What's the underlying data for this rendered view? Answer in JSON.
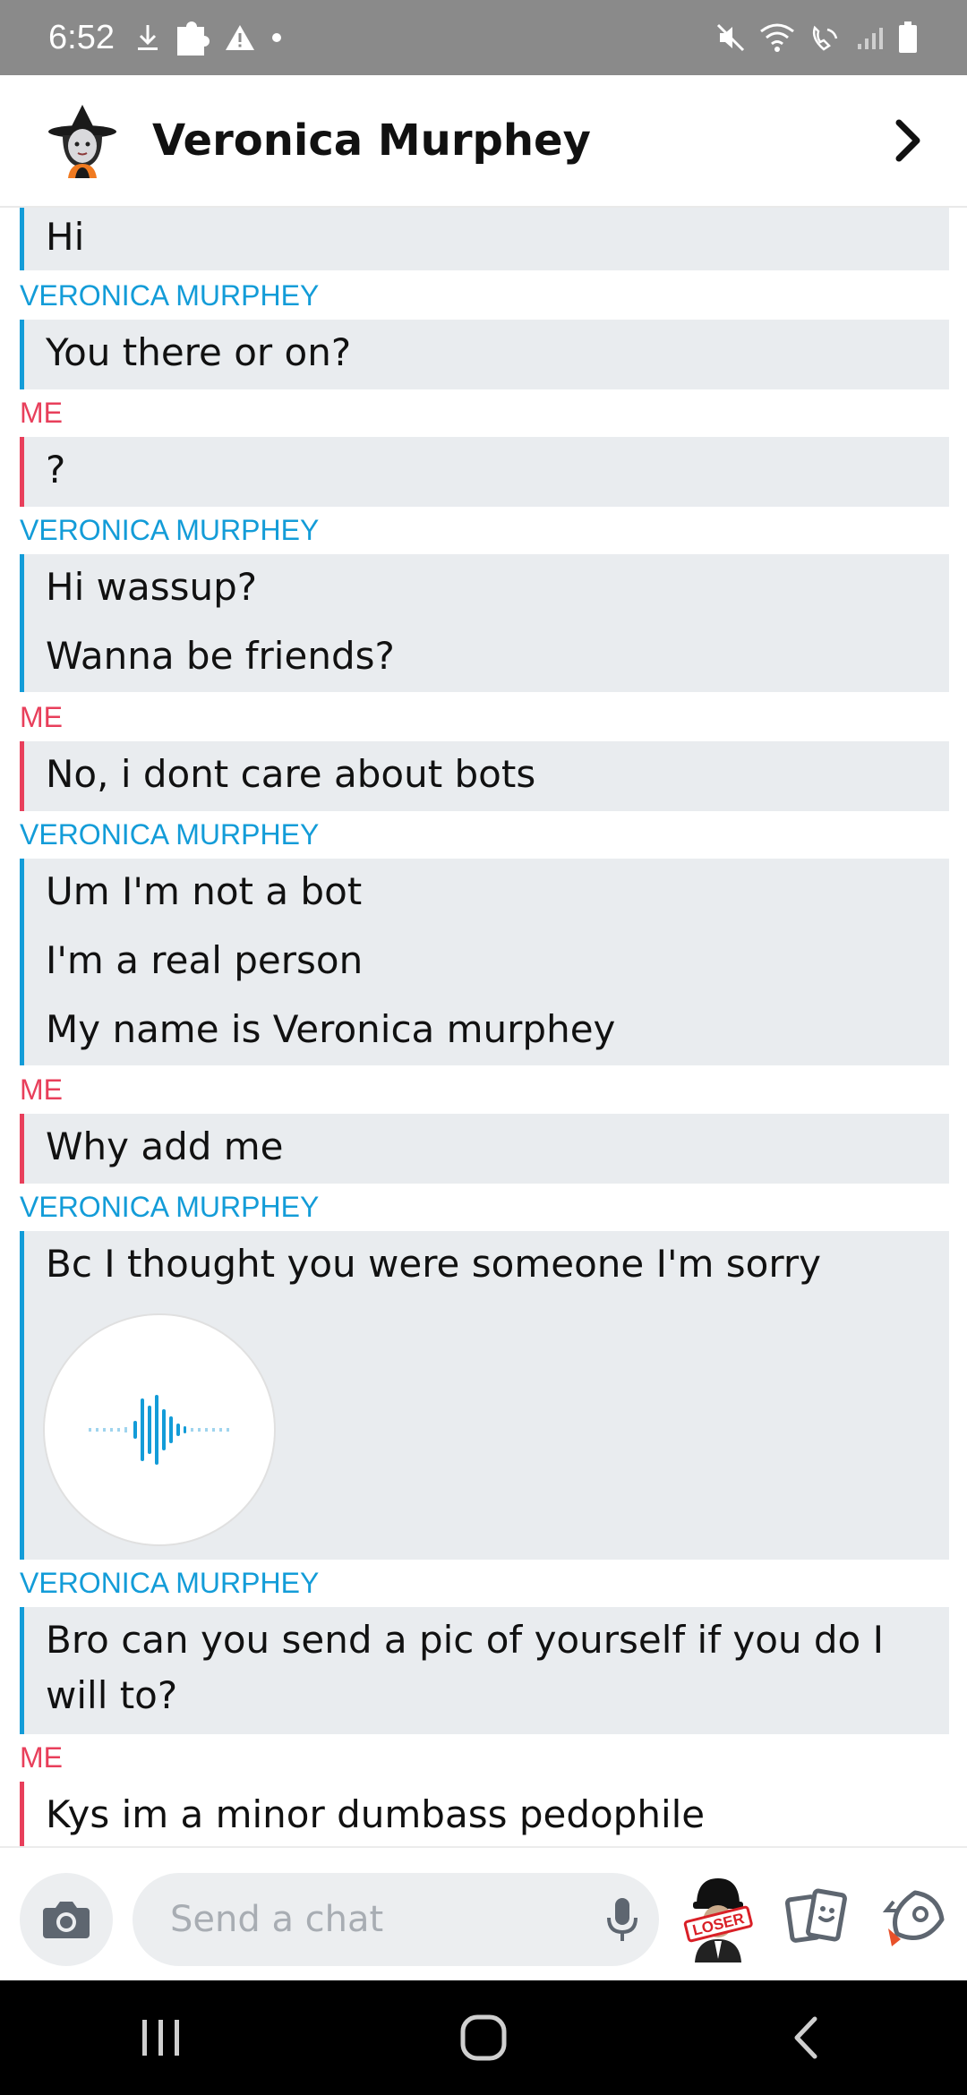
{
  "status_bar": {
    "time": "6:52",
    "left_icons": [
      "download-icon",
      "puzzle-icon",
      "warning-icon",
      "dot-icon"
    ],
    "right_icons": [
      "mute-icon",
      "wifi-icon",
      "wifi-calling-icon",
      "signal-icon",
      "battery-icon"
    ]
  },
  "header": {
    "contact_name": "Veronica Murphey",
    "avatar": "bitmoji-witch-avatar",
    "chevron": "chevron-right-icon"
  },
  "colors": {
    "them": "#139cd8",
    "me": "#e83f5b",
    "bubble_bg": "#e9ecef",
    "status_bar": "#8a8a8a"
  },
  "messages": {
    "g0": {
      "lines": [
        "Hi"
      ]
    },
    "g1": {
      "sender": "VERONICA MURPHEY",
      "lines": [
        "You there or on?"
      ]
    },
    "g2": {
      "sender": "ME",
      "lines": [
        "?"
      ]
    },
    "g3": {
      "sender": "VERONICA MURPHEY",
      "lines": [
        "Hi wassup?",
        "Wanna be friends?"
      ]
    },
    "g4": {
      "sender": "ME",
      "lines": [
        "No, i dont care about bots"
      ]
    },
    "g5": {
      "sender": "VERONICA MURPHEY",
      "lines": [
        "Um I'm not a bot",
        "I'm a real person",
        "My name is Veronica murphey"
      ]
    },
    "g6": {
      "sender": "ME",
      "lines": [
        "Why add me"
      ]
    },
    "g7": {
      "sender": "VERONICA MURPHEY",
      "lines": [
        "Bc I thought you were someone I'm sorry"
      ],
      "attachment": "voice-note"
    },
    "g8": {
      "sender": "VERONICA MURPHEY",
      "lines": [
        "Bro can you send a pic of yourself if you do I",
        "will to?"
      ]
    },
    "g9": {
      "sender": "ME",
      "lines": [
        "Kys im a minor dumbass pedophile"
      ]
    }
  },
  "input_bar": {
    "placeholder": "Send a chat",
    "icons": [
      "camera-icon",
      "mic-icon",
      "bitmoji-sticker-icon",
      "cards-icon",
      "games-rocket-icon"
    ],
    "bitmoji_sticker_text": "LOSER"
  },
  "nav_bar": {
    "icons": [
      "recent-apps-icon",
      "home-icon",
      "back-icon"
    ]
  }
}
